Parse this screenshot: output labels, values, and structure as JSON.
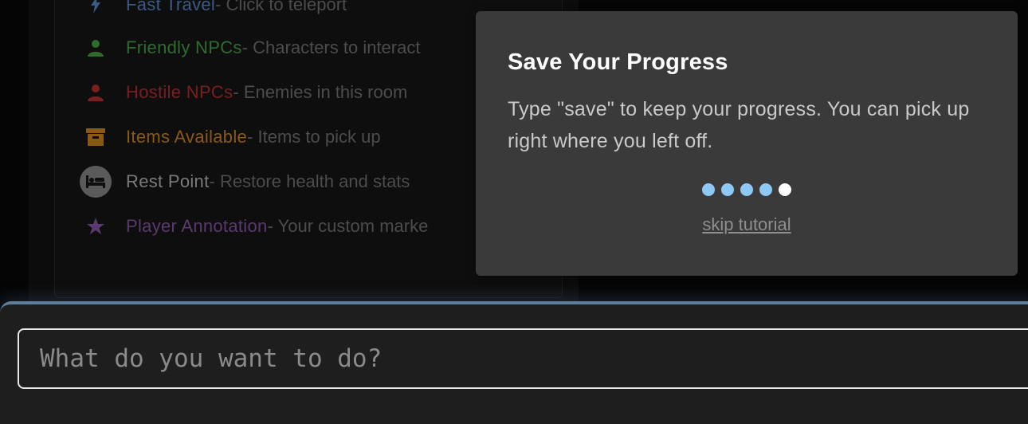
{
  "legend": {
    "items": [
      {
        "name": "Fast Travel",
        "desc": " - Click to teleport",
        "color": "#3b5b86",
        "icon": "lightning-icon"
      },
      {
        "name": "Friendly NPCs",
        "desc": " - Characters to interact",
        "color": "#2f6b2f",
        "icon": "person-icon"
      },
      {
        "name": "Hostile NPCs",
        "desc": " - Enemies in this room",
        "color": "#7a1f1f",
        "icon": "person-icon"
      },
      {
        "name": "Items Available",
        "desc": " - Items to pick up",
        "color": "#8a5a14",
        "icon": "box-icon"
      },
      {
        "name": "Rest Point",
        "desc": " - Restore health and stats",
        "color": "#7a7a7a",
        "icon": "bed-icon"
      },
      {
        "name": "Player Annotation",
        "desc": " - Your custom marke",
        "color": "#5a3a6e",
        "icon": "star-icon"
      }
    ]
  },
  "tutorial": {
    "title": "Save Your Progress",
    "body": "Type \"save\" to keep your progress. You can pick up right where you left off.",
    "steps_total": 5,
    "current_step": 5,
    "skip_label": "skip tutorial"
  },
  "command": {
    "placeholder": "What do you want to do?",
    "value": ""
  }
}
